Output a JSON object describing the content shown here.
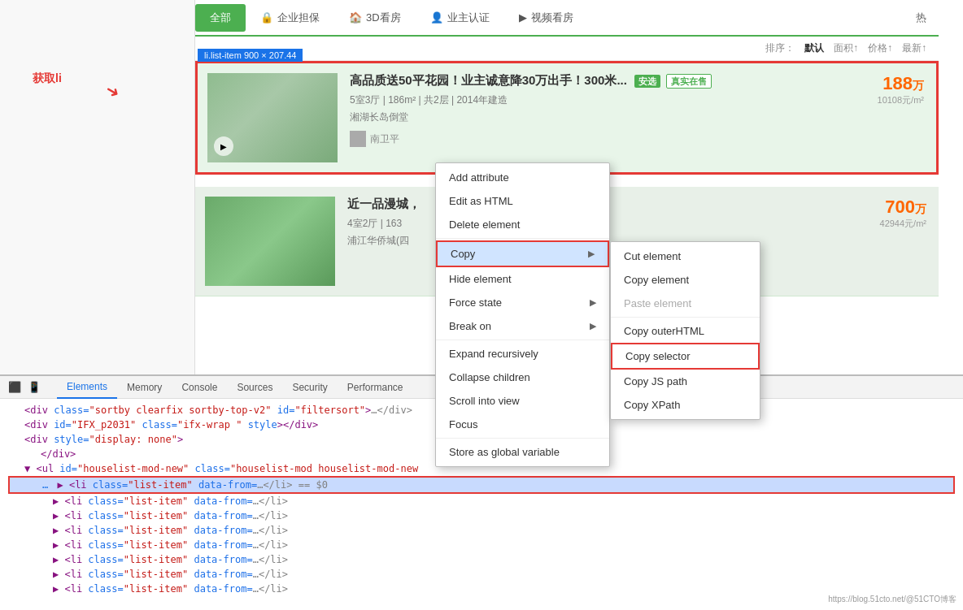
{
  "nav": {
    "tabs": [
      {
        "label": "全部",
        "active": true
      },
      {
        "label": "企业担保",
        "icon": "🔒"
      },
      {
        "label": "3D看房",
        "icon": "🏠"
      },
      {
        "label": "业主认证",
        "icon": "👤"
      },
      {
        "label": "视频看房",
        "icon": "▶"
      }
    ]
  },
  "sort": {
    "label": "排序：",
    "options": [
      "默认",
      "面积↑",
      "价格↑",
      "最新↑"
    ]
  },
  "listing1": {
    "title": "高品质送50平花园！业主诚意降30万出手！300米...",
    "badge1": "安选",
    "badge2": "真实在售",
    "details": "5室3厅 | 186m² | 共2层 | 2014年建造",
    "location": "湘湖长岛倒堂",
    "price": "188",
    "price_unit": "万",
    "price_sub": "10108元/m²",
    "agent": "南卫平"
  },
  "listing2": {
    "title": "近一品漫城，",
    "details": "4室2厅 | 163",
    "location": "浦江华侨城(四",
    "price": "700",
    "price_unit": "万",
    "price_sub": "42944元/m²"
  },
  "element_tag": "li.list-item  900 × 207.44",
  "get_label": "获取li",
  "context_menu": {
    "items": [
      {
        "label": "Add attribute",
        "hasArrow": false
      },
      {
        "label": "Edit as HTML",
        "hasArrow": false
      },
      {
        "label": "Delete element",
        "hasArrow": false
      },
      {
        "label": "Copy",
        "hasArrow": true,
        "active": true
      },
      {
        "label": "Hide element",
        "hasArrow": false
      },
      {
        "label": "Force state",
        "hasArrow": true
      },
      {
        "label": "Break on",
        "hasArrow": true
      },
      {
        "label": "Expand recursively",
        "hasArrow": false
      },
      {
        "label": "Collapse children",
        "hasArrow": false
      },
      {
        "label": "Scroll into view",
        "hasArrow": false
      },
      {
        "label": "Focus",
        "hasArrow": false
      },
      {
        "label": "Store as global variable",
        "hasArrow": false
      }
    ]
  },
  "sub_menu": {
    "items": [
      {
        "label": "Cut element",
        "disabled": false
      },
      {
        "label": "Copy element",
        "disabled": false
      },
      {
        "label": "Paste element",
        "disabled": true
      },
      {
        "label": "Copy outerHTML",
        "disabled": false
      },
      {
        "label": "Copy selector",
        "disabled": false,
        "highlighted": true
      },
      {
        "label": "Copy JS path",
        "disabled": false
      },
      {
        "label": "Copy XPath",
        "disabled": false
      }
    ]
  },
  "devtools": {
    "tabs": [
      "Elements",
      "Memory",
      "Console",
      "Sources",
      "Security",
      "Performance"
    ],
    "active_tab": "Elements",
    "code_lines": [
      {
        "text": "<div class=\"sortby clearfix sortby-top-v2\" id=\"filtersort\">...</div>",
        "indent": 1
      },
      {
        "text": "<div id=\"IFX_p2031\" class=\"ifx-wrap \" style></div>",
        "indent": 1
      },
      {
        "text": "<div style=\"display: none\">",
        "indent": 1
      },
      {
        "text": "",
        "indent": 0
      },
      {
        "text": "</div>",
        "indent": 2
      },
      {
        "text": "<ul id=\"houselist-mod-new\" class=\"houselist-mod houselist-mod-new",
        "indent": 1
      },
      {
        "text": "<li class=\"list-item\" data-from=…</li> == $0",
        "indent": 2,
        "highlighted": true
      },
      {
        "text": "<li class=\"list-item\" data-from=…</li>",
        "indent": 3
      },
      {
        "text": "<li class=\"list-item\" data-from=…</li>",
        "indent": 3
      },
      {
        "text": "<li class=\"list-item\" data-from=…</li>",
        "indent": 3
      },
      {
        "text": "<li class=\"list-item\" data-from=…</li>",
        "indent": 3
      },
      {
        "text": "<li class=\"list-item\" data-from=…</li>",
        "indent": 3
      },
      {
        "text": "<li class=\"list-item\" data-from=…</li>",
        "indent": 3
      },
      {
        "text": "<li class=\"list-item\" data-from=…</li>",
        "indent": 3
      }
    ]
  },
  "watermark": "https://blog.51cto.net/@51CTO博客"
}
